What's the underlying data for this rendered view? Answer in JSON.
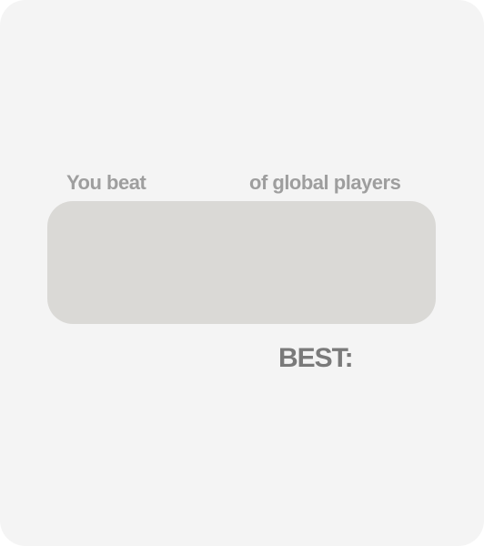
{
  "result": {
    "beat_prefix": "You beat",
    "beat_suffix": "of global players",
    "best_label": "BEST:"
  },
  "colors": {
    "panel_background": "#f4f4f4",
    "score_box": "#dad9d6",
    "secondary_text": "#9e9e9e",
    "best_text": "#7a7a7a"
  }
}
